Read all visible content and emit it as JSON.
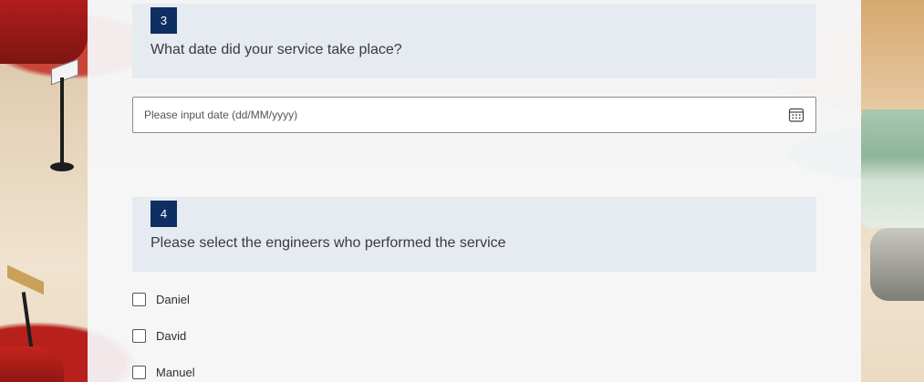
{
  "questions": [
    {
      "number": "3",
      "title": "What date did your service take place?",
      "date_placeholder": "Please input date (dd/MM/yyyy)",
      "date_value": ""
    },
    {
      "number": "4",
      "title": "Please select the engineers who performed the service",
      "options": [
        {
          "label": "Daniel",
          "checked": false
        },
        {
          "label": "David",
          "checked": false
        },
        {
          "label": "Manuel",
          "checked": false
        }
      ]
    }
  ],
  "icons": {
    "calendar": "calendar-icon"
  },
  "colors": {
    "accent": "#0f2f63",
    "header_bg": "#e6eaf1"
  }
}
